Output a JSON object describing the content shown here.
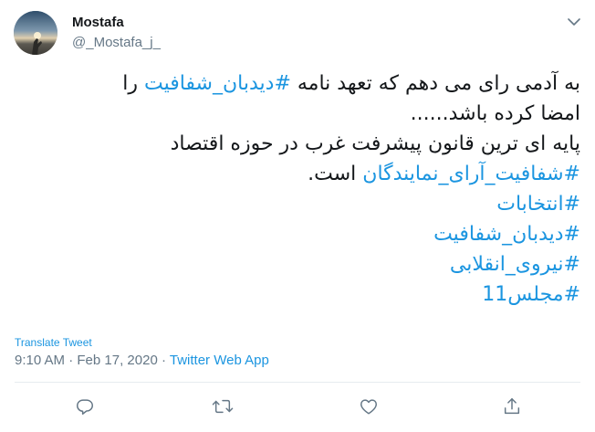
{
  "author": {
    "display_name": "Mostafa",
    "handle": "@_Mostafa_j_"
  },
  "tweet": {
    "lines": [
      [
        {
          "text": "به آدمی رای می دهم که تعهد نامه ",
          "hashtag": false
        },
        {
          "text": "#دیدبان_شفافیت",
          "hashtag": true
        },
        {
          "text": " را",
          "hashtag": false
        }
      ],
      [
        {
          "text": "امضا کرده باشد......",
          "hashtag": false
        }
      ],
      [
        {
          "text": "پایه ای ترین قانون پیشرفت غرب در حوزه اقتصاد",
          "hashtag": false
        }
      ],
      [
        {
          "text": "#شفافیت_آرای_نمایندگان",
          "hashtag": true
        },
        {
          "text": " است.",
          "hashtag": false
        }
      ],
      [
        {
          "text": "#انتخابات",
          "hashtag": true
        }
      ],
      [
        {
          "text": "#دیدبان_شفافیت",
          "hashtag": true
        }
      ],
      [
        {
          "text": "#نیروی_انقلابی",
          "hashtag": true
        }
      ],
      [
        {
          "text": "#مجلس11",
          "hashtag": true
        }
      ]
    ]
  },
  "translate_label": "Translate Tweet",
  "meta": {
    "time": "9:10 AM",
    "separator": "·",
    "date": "Feb 17, 2020",
    "source": "Twitter Web App"
  },
  "icons": {
    "caret": "chevron-down-icon",
    "reply": "reply-icon",
    "retweet": "retweet-icon",
    "like": "like-icon",
    "share": "share-icon"
  },
  "colors": {
    "link": "#1b95e0",
    "secondary": "#657786",
    "text": "#14171a",
    "divider": "#e6ecf0"
  }
}
